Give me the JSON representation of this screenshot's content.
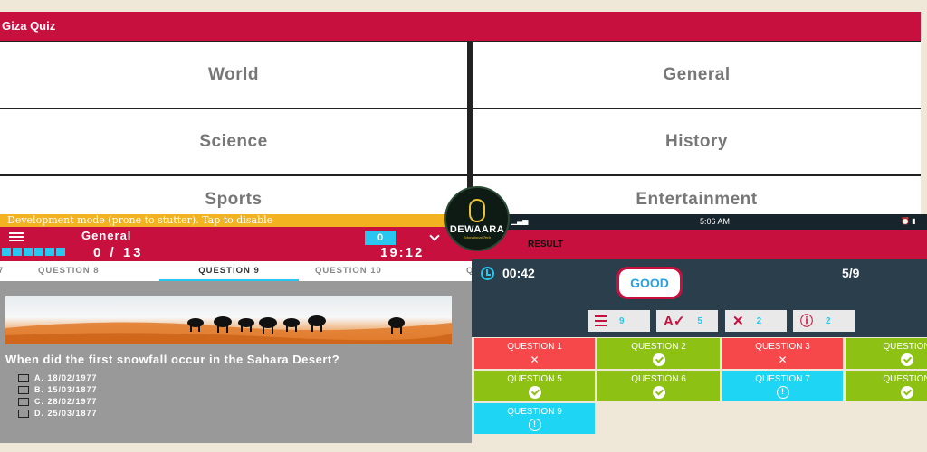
{
  "menu": {
    "title": "Giza Quiz",
    "categories": [
      "World",
      "General",
      "Science",
      "History",
      "Sports",
      "Entertainment"
    ]
  },
  "quiz": {
    "dev_banner": "Development mode (prone to stutter). Tap to disable",
    "category": "General",
    "score": "0",
    "progress": "0 / 13",
    "timer": "19:12",
    "tabs": [
      "7",
      "QUESTION 8",
      "QUESTION 9",
      "QUESTION 10",
      "Q"
    ],
    "active_tab": "QUESTION 9",
    "question": "When did the first snowfall occur in the Sahara Desert?",
    "options": [
      "A. 18/02/1977",
      "B. 15/03/1877",
      "C. 28/02/1977",
      "D. 25/03/1877"
    ]
  },
  "logo": {
    "name": "DEWAARA",
    "tagline": "Educational Tech"
  },
  "result": {
    "status_time": "5:06 AM",
    "title": "RESULT",
    "time": "00:42",
    "grade": "GOOD",
    "score": "5/9",
    "stats": {
      "total": "9",
      "correct": "5",
      "wrong": "2",
      "skipped": "2"
    },
    "questions": [
      {
        "label": "QUESTION 1",
        "state": "wrong"
      },
      {
        "label": "QUESTION 2",
        "state": "right"
      },
      {
        "label": "QUESTION 3",
        "state": "wrong"
      },
      {
        "label": "QUESTION",
        "state": "right"
      },
      {
        "label": "QUESTION 5",
        "state": "right"
      },
      {
        "label": "QUESTION 6",
        "state": "right"
      },
      {
        "label": "QUESTION 7",
        "state": "skip"
      },
      {
        "label": "QUESTION",
        "state": "right"
      },
      {
        "label": "QUESTION 9",
        "state": "skip"
      }
    ]
  },
  "colors": {
    "primary": "#c8103e",
    "accent": "#29c7f0",
    "correct": "#8dc215",
    "wrong": "#f6474a",
    "dark": "#2b3e4b"
  }
}
